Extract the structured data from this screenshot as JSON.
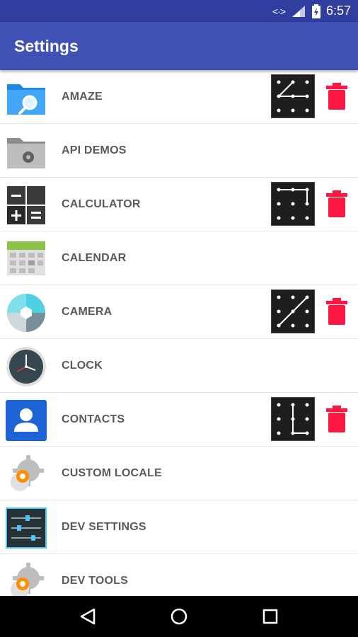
{
  "status_bar": {
    "time": "6:57",
    "data_icon": "<·>",
    "signal_icon": "signal-icon",
    "battery_icon": "battery-icon"
  },
  "app_bar": {
    "title": "Settings"
  },
  "apps": [
    {
      "label": "AMAZE",
      "icon": "amaze-folder-icon",
      "locked": true
    },
    {
      "label": "API DEMOS",
      "icon": "api-demos-folder-icon",
      "locked": false
    },
    {
      "label": "CALCULATOR",
      "icon": "calculator-icon",
      "locked": true
    },
    {
      "label": "CALENDAR",
      "icon": "calendar-icon",
      "locked": false
    },
    {
      "label": "CAMERA",
      "icon": "camera-icon",
      "locked": true
    },
    {
      "label": "CLOCK",
      "icon": "clock-icon",
      "locked": false
    },
    {
      "label": "CONTACTS",
      "icon": "contacts-icon",
      "locked": true
    },
    {
      "label": "CUSTOM LOCALE",
      "icon": "custom-locale-icon",
      "locked": false
    },
    {
      "label": "DEV SETTINGS",
      "icon": "dev-settings-icon",
      "locked": false
    },
    {
      "label": "DEV TOOLS",
      "icon": "dev-tools-icon",
      "locked": false
    }
  ],
  "nav_bar": {
    "back_icon": "back-icon",
    "home_icon": "home-icon",
    "recents_icon": "recents-icon"
  },
  "colors": {
    "status_bar": "#303f9f",
    "app_bar": "#3f51b5",
    "trash": "#ff1744",
    "label": "#5a5a5a"
  }
}
